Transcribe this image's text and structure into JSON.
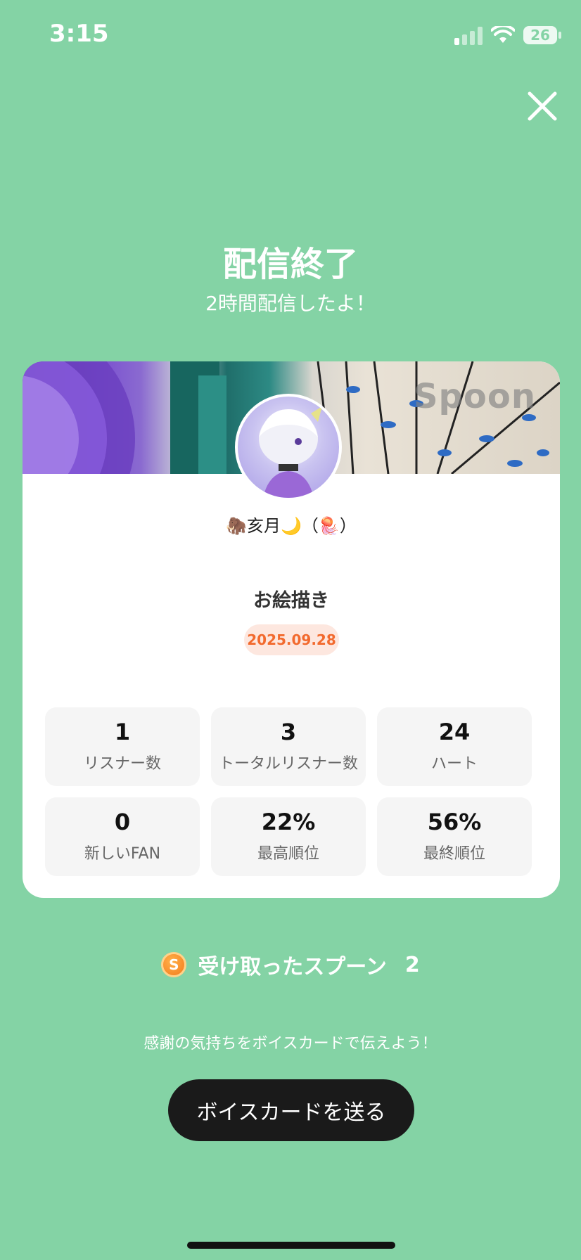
{
  "status_bar": {
    "time": "3:15",
    "battery": "26"
  },
  "header": {
    "title": "配信終了",
    "subtitle": "2時間配信したよ！"
  },
  "card": {
    "banner_watermark": "Spoon",
    "username": "🦣亥月🌙（🪼）",
    "stream_title": "お絵描き",
    "date": "2025.09.28",
    "stats": [
      {
        "value": "1",
        "label": "リスナー数"
      },
      {
        "value": "3",
        "label": "トータルリスナー数"
      },
      {
        "value": "24",
        "label": "ハート"
      },
      {
        "value": "0",
        "label": "新しいFAN"
      },
      {
        "value": "22%",
        "label": "最高順位"
      },
      {
        "value": "56%",
        "label": "最終順位"
      }
    ]
  },
  "spoons": {
    "coin_letter": "S",
    "label": "受け取ったスプーン",
    "count": "2"
  },
  "footer": {
    "thanks_text": "感謝の気持ちをボイスカードで伝えよう！",
    "voice_card_button": "ボイスカードを送る"
  },
  "colors": {
    "background": "#84d3a5",
    "date_badge_bg": "#fde7df",
    "date_badge_text": "#f26a2e",
    "button_bg": "#1a1a1a"
  }
}
